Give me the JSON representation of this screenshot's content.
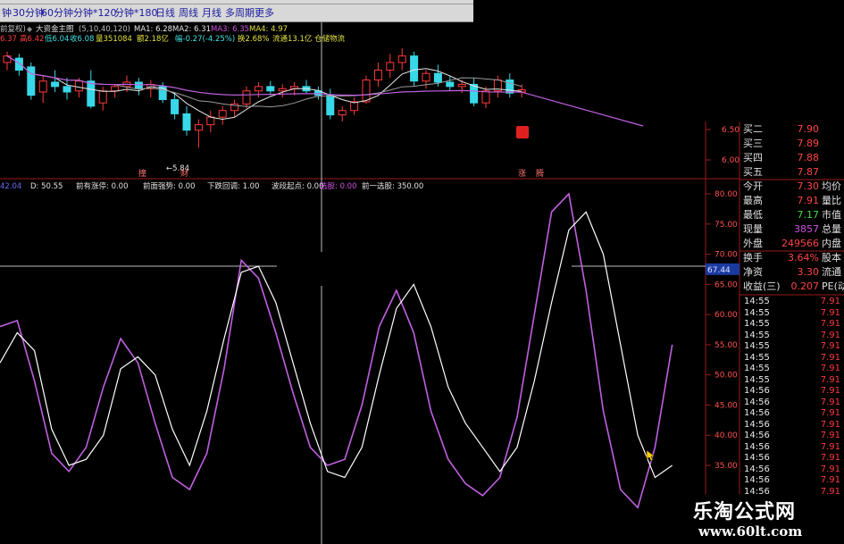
{
  "toolbar": {
    "tabs": [
      "钟",
      "30分钟",
      "60分钟",
      "分钟*120",
      "分钟*180",
      "日线",
      "周线",
      "月线",
      "多周期",
      "更多"
    ]
  },
  "main_chart": {
    "indicator_title": "大资金主图",
    "info_prefix": "前复权)",
    "ma_params": "(5,10,40,120)",
    "ma_values": {
      "ma1": "MA1: 6.28",
      "ma2": "MA2: 6.31",
      "ma3": "MA3: 6.35",
      "ma4": "MA4: 4.97"
    },
    "quote_line": {
      "price": "6.37",
      "high": "高6.42",
      "low": "低6.04",
      "close": "收6.08",
      "volume": "量351084",
      "amount": "额2.18亿",
      "change": "幅-0.27(-4.25%)",
      "turnover": "换2.68%",
      "float": "流通13.1亿",
      "sector": "仓储物流"
    },
    "low_marker": "5.84",
    "annotations": [
      "撞",
      "财",
      "涨",
      "腾"
    ],
    "price_axis": [
      "6.50",
      "6.00"
    ]
  },
  "sub_chart": {
    "info": {
      "left": "42.04",
      "d": "D: 50.55",
      "limit_up": "前有涨停: 0.00",
      "strength": "前面强势: 0.00",
      "pullback": "下跌回调: 1.00",
      "start": "波段起点: 0.00",
      "pick": "选股: 0.00",
      "pick_one": "前一选股: 350.00"
    },
    "axis_labels": [
      "80.00",
      "75.00",
      "70.00",
      "65.00",
      "60.00",
      "55.00",
      "50.00",
      "45.00",
      "40.00",
      "35.00"
    ],
    "cursor_value": "67.44"
  },
  "quote_panel": {
    "rows": [
      {
        "label": "买二",
        "value": "7.90",
        "tail": ""
      },
      {
        "label": "买三",
        "value": "7.89",
        "tail": ""
      },
      {
        "label": "买四",
        "value": "7.88",
        "tail": ""
      },
      {
        "label": "买五",
        "value": "7.87",
        "tail": ""
      },
      {
        "label": "今开",
        "value": "7.30",
        "tail": "均价"
      },
      {
        "label": "最高",
        "value": "7.91",
        "tail": "量比"
      },
      {
        "label": "最低",
        "value": "7.17",
        "tail": "市值"
      },
      {
        "label": "现量",
        "value": "3857",
        "tail": "总量"
      },
      {
        "label": "外盘",
        "value": "249566",
        "tail": "内盘"
      },
      {
        "label": "换手",
        "value": "3.64%",
        "tail": "股本"
      },
      {
        "label": "净资",
        "value": "3.30",
        "tail": "流通"
      },
      {
        "label": "收益(三)",
        "value": "0.207",
        "tail": "PE(动"
      }
    ],
    "ticks": [
      {
        "time": "14:55",
        "price": "7.91"
      },
      {
        "time": "14:55",
        "price": "7.91"
      },
      {
        "time": "14:55",
        "price": "7.91"
      },
      {
        "time": "14:55",
        "price": "7.91"
      },
      {
        "time": "14:55",
        "price": "7.91"
      },
      {
        "time": "14:55",
        "price": "7.91"
      },
      {
        "time": "14:55",
        "price": "7.91"
      },
      {
        "time": "14:55",
        "price": "7.91"
      },
      {
        "time": "14:56",
        "price": "7.91"
      },
      {
        "time": "14:56",
        "price": "7.91"
      },
      {
        "time": "14:56",
        "price": "7.91"
      },
      {
        "time": "14:56",
        "price": "7.91"
      },
      {
        "time": "14:56",
        "price": "7.91"
      },
      {
        "time": "14:56",
        "price": "7.91"
      },
      {
        "time": "14:56",
        "price": "7.91"
      },
      {
        "time": "14:56",
        "price": "7.91"
      },
      {
        "time": "14:56",
        "price": "7.91"
      },
      {
        "time": "14:56",
        "price": "7.91"
      }
    ]
  },
  "watermark": {
    "title": "乐淘公式网",
    "url": "www.60lt.com"
  },
  "colors": {
    "up": "#ff3a3a",
    "down": "#38d8e8",
    "ma_white": "#e8e8e8",
    "ma_purple": "#c060e0",
    "axis_red": "#9a1a1a",
    "k_line": "#ffffff",
    "d_line": "#c060e0"
  },
  "chart_data": [
    {
      "type": "candlestick",
      "title": "大资金主图",
      "ylim": [
        5.7,
        6.8
      ],
      "ohlc": [
        [
          6.62,
          6.72,
          6.55,
          6.68
        ],
        [
          6.66,
          6.7,
          6.5,
          6.55
        ],
        [
          6.58,
          6.62,
          6.28,
          6.32
        ],
        [
          6.35,
          6.5,
          6.25,
          6.45
        ],
        [
          6.44,
          6.55,
          6.35,
          6.4
        ],
        [
          6.4,
          6.48,
          6.28,
          6.35
        ],
        [
          6.36,
          6.48,
          6.3,
          6.45
        ],
        [
          6.45,
          6.55,
          6.2,
          6.22
        ],
        [
          6.25,
          6.4,
          6.18,
          6.36
        ],
        [
          6.36,
          6.42,
          6.3,
          6.4
        ],
        [
          6.4,
          6.5,
          6.35,
          6.44
        ],
        [
          6.44,
          6.48,
          6.32,
          6.38
        ],
        [
          6.38,
          6.46,
          6.3,
          6.42
        ],
        [
          6.4,
          6.44,
          6.25,
          6.28
        ],
        [
          6.28,
          6.35,
          6.1,
          6.15
        ],
        [
          6.15,
          6.22,
          5.95,
          6.0
        ],
        [
          6.0,
          6.1,
          5.84,
          6.05
        ],
        [
          6.05,
          6.18,
          5.98,
          6.12
        ],
        [
          6.12,
          6.22,
          6.05,
          6.18
        ],
        [
          6.18,
          6.28,
          6.12,
          6.24
        ],
        [
          6.24,
          6.4,
          6.2,
          6.36
        ],
        [
          6.36,
          6.44,
          6.3,
          6.4
        ],
        [
          6.4,
          6.45,
          6.32,
          6.36
        ],
        [
          6.36,
          6.42,
          6.3,
          6.38
        ],
        [
          6.38,
          6.44,
          6.32,
          6.4
        ],
        [
          6.4,
          6.46,
          6.34,
          6.36
        ],
        [
          6.36,
          6.4,
          6.28,
          6.32
        ],
        [
          6.32,
          6.38,
          6.1,
          6.14
        ],
        [
          6.14,
          6.22,
          6.08,
          6.18
        ],
        [
          6.18,
          6.3,
          6.14,
          6.26
        ],
        [
          6.26,
          6.5,
          6.24,
          6.46
        ],
        [
          6.46,
          6.62,
          6.4,
          6.55
        ],
        [
          6.55,
          6.7,
          6.48,
          6.62
        ],
        [
          6.62,
          6.75,
          6.55,
          6.68
        ],
        [
          6.68,
          6.72,
          6.4,
          6.45
        ],
        [
          6.45,
          6.55,
          6.38,
          6.52
        ],
        [
          6.52,
          6.6,
          6.4,
          6.44
        ],
        [
          6.44,
          6.5,
          6.36,
          6.4
        ],
        [
          6.4,
          6.46,
          6.34,
          6.42
        ],
        [
          6.42,
          6.48,
          6.22,
          6.25
        ],
        [
          6.25,
          6.4,
          6.2,
          6.36
        ],
        [
          6.36,
          6.5,
          6.3,
          6.46
        ],
        [
          6.46,
          6.52,
          6.3,
          6.34
        ],
        [
          6.35,
          6.42,
          6.3,
          6.37
        ]
      ]
    },
    {
      "type": "line",
      "title": "",
      "ylim": [
        30,
        82
      ],
      "series": [
        {
          "values": [
            52,
            57,
            54,
            41,
            35,
            36,
            40,
            51,
            53,
            50,
            41,
            35,
            44,
            56,
            67,
            68,
            62,
            52,
            42,
            34,
            33,
            38,
            50,
            61,
            65,
            58,
            48,
            42,
            38,
            34,
            38,
            49,
            62,
            74,
            77,
            70,
            55,
            40,
            33,
            35
          ]
        },
        {
          "values": [
            58,
            59,
            49,
            37,
            34,
            38,
            48,
            56,
            52,
            42,
            33,
            31,
            37,
            51,
            69,
            66,
            57,
            47,
            38,
            35,
            36,
            45,
            58,
            64,
            57,
            44,
            36,
            32,
            30,
            33,
            43,
            60,
            77,
            80,
            64,
            44,
            31,
            28,
            38,
            55
          ]
        }
      ]
    }
  ]
}
